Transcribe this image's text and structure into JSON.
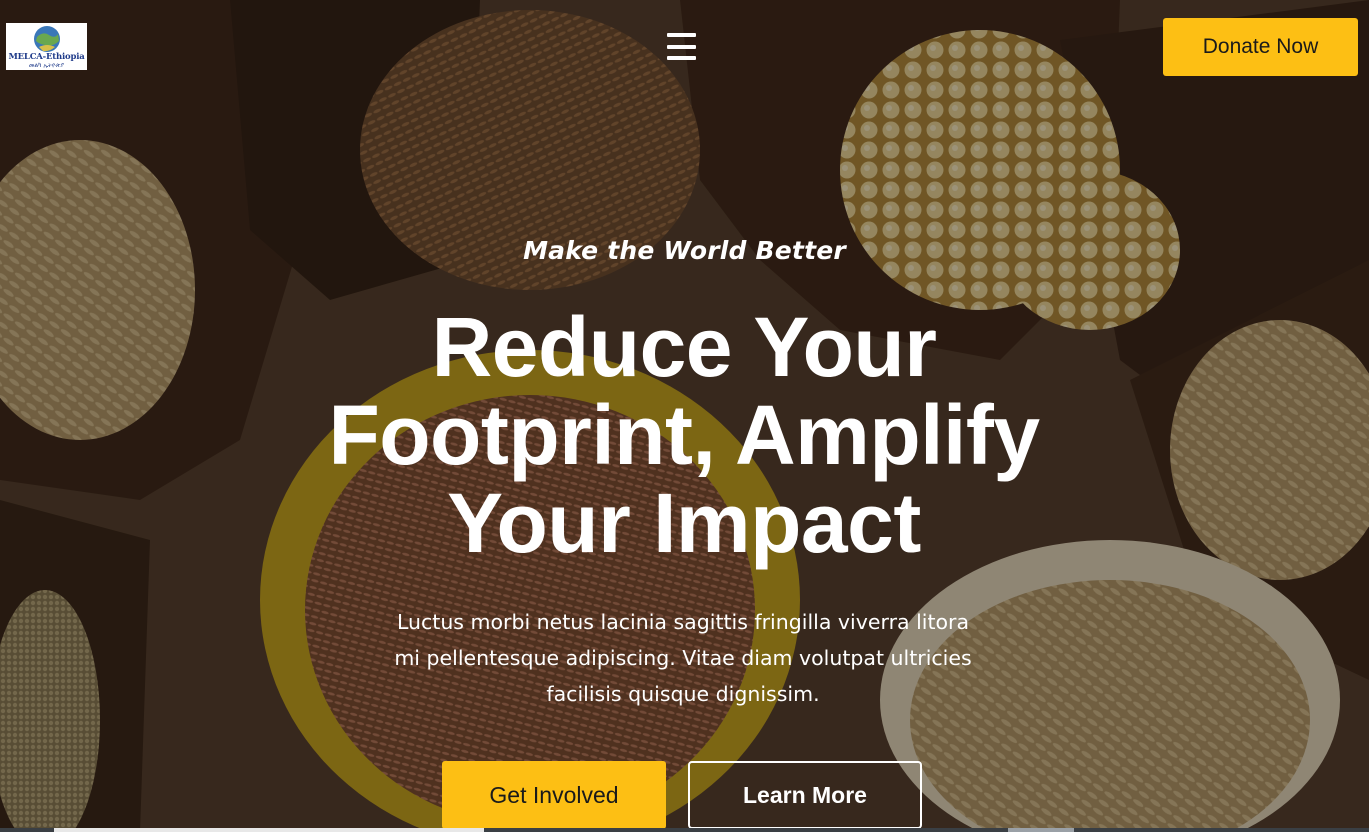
{
  "header": {
    "logo": {
      "name": "MELCA-Ethiopia",
      "subtitle": "መልካ ኢትዮጵያ"
    },
    "menu_icon": "hamburger-menu-icon",
    "donate_label": "Donate Now"
  },
  "hero": {
    "tagline": "Make the World Better",
    "headline_lines": [
      "Reduce Your",
      "Footprint, Amplify",
      "Your Impact"
    ],
    "lead_lines": [
      "Luctus morbi netus lacinia sagittis fringilla viverra litora",
      "mi pellentesque adipiscing. Vitae diam volutpat ultricies",
      "facilisis quisque dignissim."
    ],
    "primary_cta": "Get Involved",
    "secondary_cta": "Learn More"
  },
  "colors": {
    "accent": "#fdbf14",
    "text_light": "#ffffff",
    "text_dark": "#1a1a1a",
    "logo_blue": "#1f3b8a"
  }
}
